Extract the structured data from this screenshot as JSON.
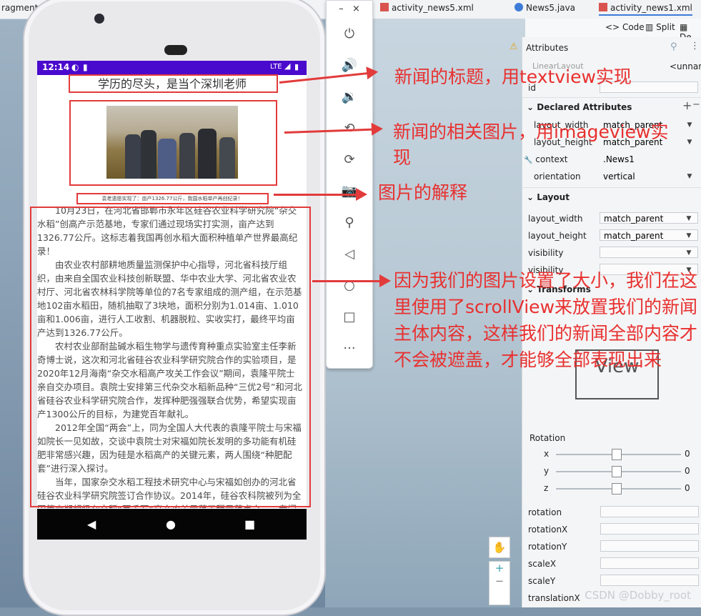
{
  "ide": {
    "tabs": [
      "ragment.i",
      "activ",
      "ml",
      "activity_news5.xml",
      "News5.java",
      "activity_news1.xml"
    ],
    "view_modes": [
      "Code",
      "Split",
      "De"
    ],
    "attributes_title": "Attributes",
    "layout_partial": "LinearLayout",
    "unnamed": "<unnam",
    "id_label": "id",
    "declared_header": "Declared Attributes",
    "declared": [
      {
        "name": "layout_width",
        "value": "match_parent"
      },
      {
        "name": "layout_height",
        "value": "match_parent"
      },
      {
        "name": "context",
        "value": ".News1"
      },
      {
        "name": "orientation",
        "value": "vertical"
      }
    ],
    "layout_header": "Layout",
    "layout_rows": [
      {
        "name": "layout_width",
        "value": "match_parent"
      },
      {
        "name": "layout_height",
        "value": "match_parent"
      },
      {
        "name": "visibility",
        "value": ""
      },
      {
        "name": "visibility",
        "value": ""
      }
    ],
    "transforms_header": "Transforms",
    "view_label": "View",
    "rotation_label": "Rotation",
    "rotation_axes": [
      {
        "axis": "x",
        "value": "0"
      },
      {
        "axis": "y",
        "value": "0"
      },
      {
        "axis": "z",
        "value": "0"
      }
    ],
    "transform_rows": [
      "rotation",
      "rotationX",
      "rotationY",
      "scaleX",
      "scaleY",
      "translationX"
    ]
  },
  "phone": {
    "time": "12:14",
    "network": "LTE",
    "news_title": "学历的尽头，是当个深圳老师",
    "caption": "袁老遗愿实现了：亩产1326.77公斤，我国水稻单产再创纪录！",
    "paragraphs": [
      "10月23日，在河北省邯郸市永年区硅谷农业科学研究院“杂交水稻”创高产示范基地，专家们通过现场实打实测，亩产达到1326.77公斤。这标志着我国再创水稻大面积种植单产世界最高纪录！",
      "由农业农村部耕地质量监测保护中心指导，河北省科技厅组织，由来自全国农业科技创新联盟、华中农业大学、河北省农业农村厅、河北省农林科学院等单位的7名专家组成的测产组，在示范基地102亩水稻田，随机抽取了3块地，面积分别为1.014亩、1.010亩和1.006亩，进行人工收割、机器脱粒、实收实打，最终平均亩产达到1326.77公斤。",
      "农村农业部耐盐碱水稻生物学与遗传育种重点实验室主任李新奇博士说，这次和河北省硅谷农业科学研究院合作的实验项目，是2020年12月海南“杂交水稻高产攻关工作会议”期间，袁隆平院士亲自交办项目。袁院士安排第三代杂交水稻新品种“三优2号”和河北省硅谷农业科学研究院合作，发挥种肥强强联合优势，希望实现亩产1300公斤的目标，为建党百年献礼。",
      "2012年全国“两会”上，同为全国人大代表的袁隆平院士与宋福如院长一见如故，交谈中袁院士对宋福如院长发明的多功能有机硅肥非常感兴趣，因为硅是水稻高产的关键元素，两人围绕“种肥配套”进行深入探讨。",
      "当年，国家杂交水稻工程技术研究中心与宋福如创办的河北省硅谷农业科学研究院签订合作协议。2014年，硅谷农科院被列为全国第六期超级杂交稻“百千万”高产攻关示范工程示范点之一，专门"
    ]
  },
  "annotations": [
    "新闻的标题，用textview实现",
    "新闻的相关图片，用imageview实现",
    "图片的解释",
    "因为我们的图片设置了大小，我们在这里使用了scrollView来放置我们的新闻主体内容，这样我们的新闻全部内容才不会被遮盖，才能够全部表现出来"
  ],
  "watermark": "CSDN @Dobby_root",
  "colors": {
    "status_bar": "#4a0acd",
    "annotation": "#e8302f",
    "nav_bar": "#050505"
  },
  "icons": [
    "power-icon",
    "volume-up-icon",
    "volume-down-icon",
    "rotate-left-icon",
    "rotate-right-icon",
    "camera-icon",
    "zoom-icon",
    "back-icon",
    "home-icon",
    "overview-icon",
    "more-icon"
  ]
}
